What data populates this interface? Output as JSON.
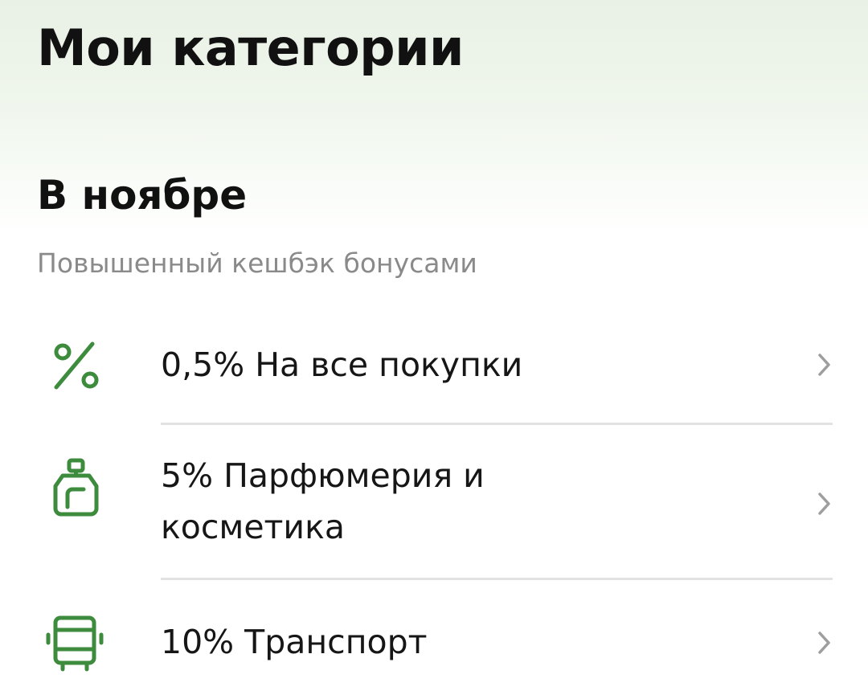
{
  "header": {
    "title": "Мои категории"
  },
  "section": {
    "title": "В ноябре",
    "subtitle": "Повышенный кешбэк бонусами"
  },
  "categories": [
    {
      "label": "0,5% На все покупки",
      "icon": "percent-icon"
    },
    {
      "label": "5% Парфюмерия и косметика",
      "icon": "perfume-bottle-icon"
    },
    {
      "label": "10% Транспорт",
      "icon": "bus-icon"
    }
  ],
  "colors": {
    "accent": "#3d8b3d",
    "chevron": "#9e9e9e",
    "subtitle": "#8a8a8a",
    "divider": "#e2e2e2"
  }
}
